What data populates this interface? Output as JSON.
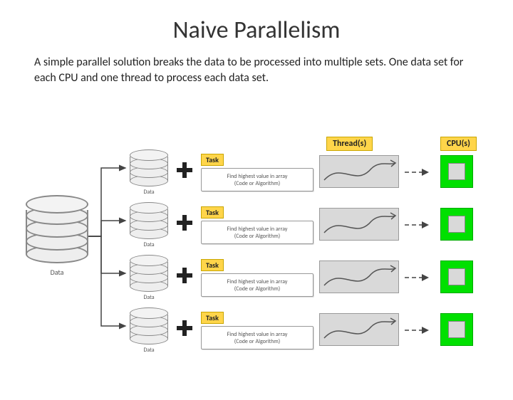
{
  "title": "Naive Parallelism",
  "description": "A simple parallel solution breaks the data to be processed into multiple sets. One data set for each CPU and one thread to process each data set.",
  "bigData": {
    "label": "Data"
  },
  "rows": [
    {
      "dataLabel": "Data",
      "taskLabel": "Task",
      "taskDesc1": "Find highest value in array",
      "taskDesc2": "(Code or Algorithm)"
    },
    {
      "dataLabel": "Data",
      "taskLabel": "Task",
      "taskDesc1": "Find highest value in array",
      "taskDesc2": "(Code or Algorithm)"
    },
    {
      "dataLabel": "Data",
      "taskLabel": "Task",
      "taskDesc1": "Find highest value in array",
      "taskDesc2": "(Code or Algorithm)"
    },
    {
      "dataLabel": "Data",
      "taskLabel": "Task",
      "taskDesc1": "Find highest value in array",
      "taskDesc2": "(Code or Algorithm)"
    }
  ],
  "headers": {
    "threads": "Thread(s)",
    "cpus": "CPU(s)"
  }
}
